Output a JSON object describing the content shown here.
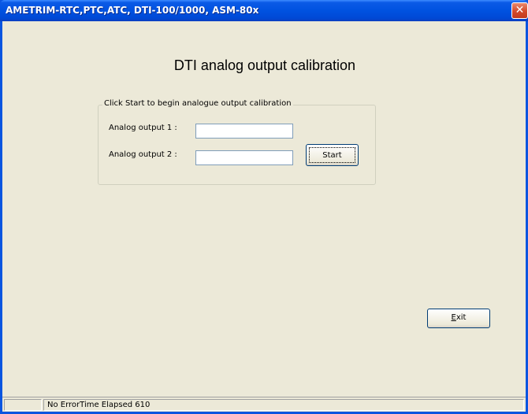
{
  "window": {
    "title": "AMETRIM-RTC,PTC,ATC, DTI-100/1000, ASM-80x",
    "close_glyph": "✕"
  },
  "main": {
    "heading": "DTI analog output calibration",
    "group_title": "Click Start to begin analogue output calibration",
    "fields": [
      {
        "label": "Analog output 1 :",
        "value": ""
      },
      {
        "label": "Analog output 2 :",
        "value": ""
      }
    ],
    "start_label": "Start",
    "exit_label": "Exit"
  },
  "statusbar": {
    "text": "No ErrorTime Elapsed 610"
  },
  "colors": {
    "titlebar": "#0052e0",
    "client_background": "#ece9d8",
    "close_button": "#d3492a"
  }
}
